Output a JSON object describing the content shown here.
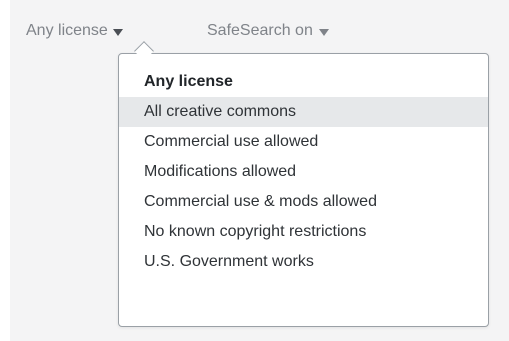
{
  "filters": {
    "license": {
      "label": "Any license",
      "icon": "caret-down-icon"
    },
    "safesearch": {
      "label": "SafeSearch on",
      "icon": "caret-down-icon"
    }
  },
  "license_menu": {
    "selected": "Any license",
    "hovered": "All creative commons",
    "items": [
      "Any license",
      "All creative commons",
      "Commercial use allowed",
      "Modifications allowed",
      "Commercial use & mods allowed",
      "No known copyright restrictions",
      "U.S. Government works"
    ]
  },
  "colors": {
    "background": "#f4f4f5",
    "filter_text": "#7f8389",
    "menu_text": "#2f3337",
    "hover_bg": "#e6e8ea",
    "border": "#9aa0a6"
  }
}
